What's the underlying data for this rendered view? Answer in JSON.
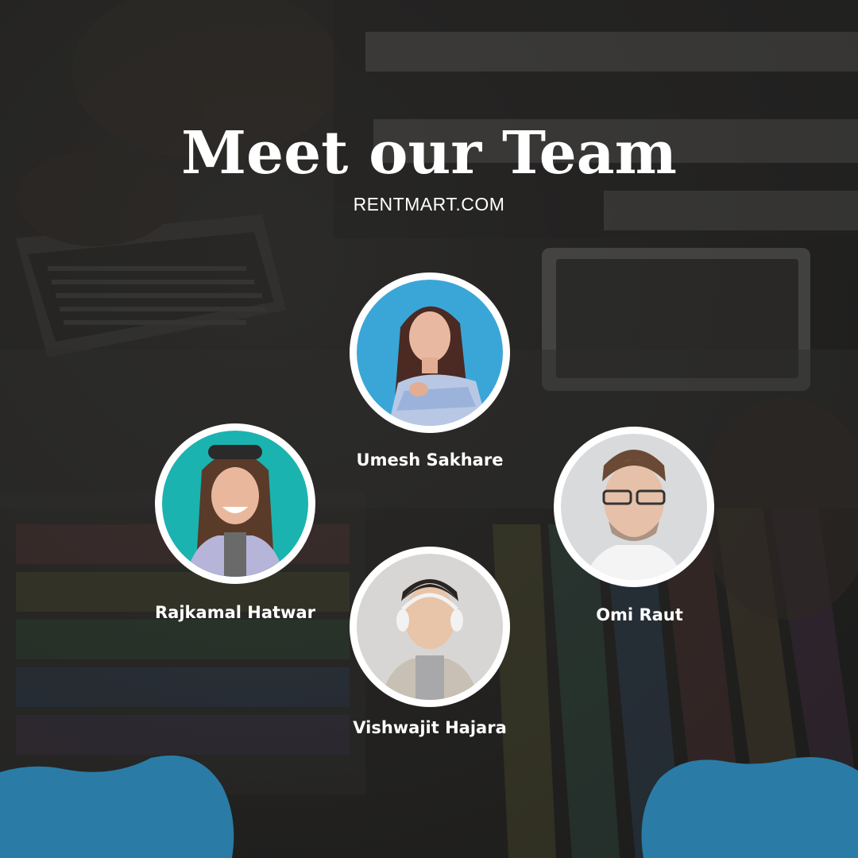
{
  "header": {
    "title": "Meet our Team",
    "website": "RENTMART.COM"
  },
  "team": [
    {
      "name": "Umesh Sakhare",
      "photo_bg": "#3aa6d8",
      "photo_icon": "woman-portrait-icon"
    },
    {
      "name": "Rajkamal Hatwar",
      "photo_bg": "#1bb3b0",
      "photo_icon": "girl-portrait-icon"
    },
    {
      "name": "Omi Raut",
      "photo_bg": "#d9dadc",
      "photo_icon": "man-portrait-icon"
    },
    {
      "name": "Vishwajit Hajara",
      "photo_bg": "#d7d6d4",
      "photo_icon": "boy-portrait-icon"
    }
  ],
  "colors": {
    "accent_blob": "#2a7ca6",
    "ring": "#ffffff",
    "text": "#ffffff",
    "background": "#2b2a28"
  }
}
